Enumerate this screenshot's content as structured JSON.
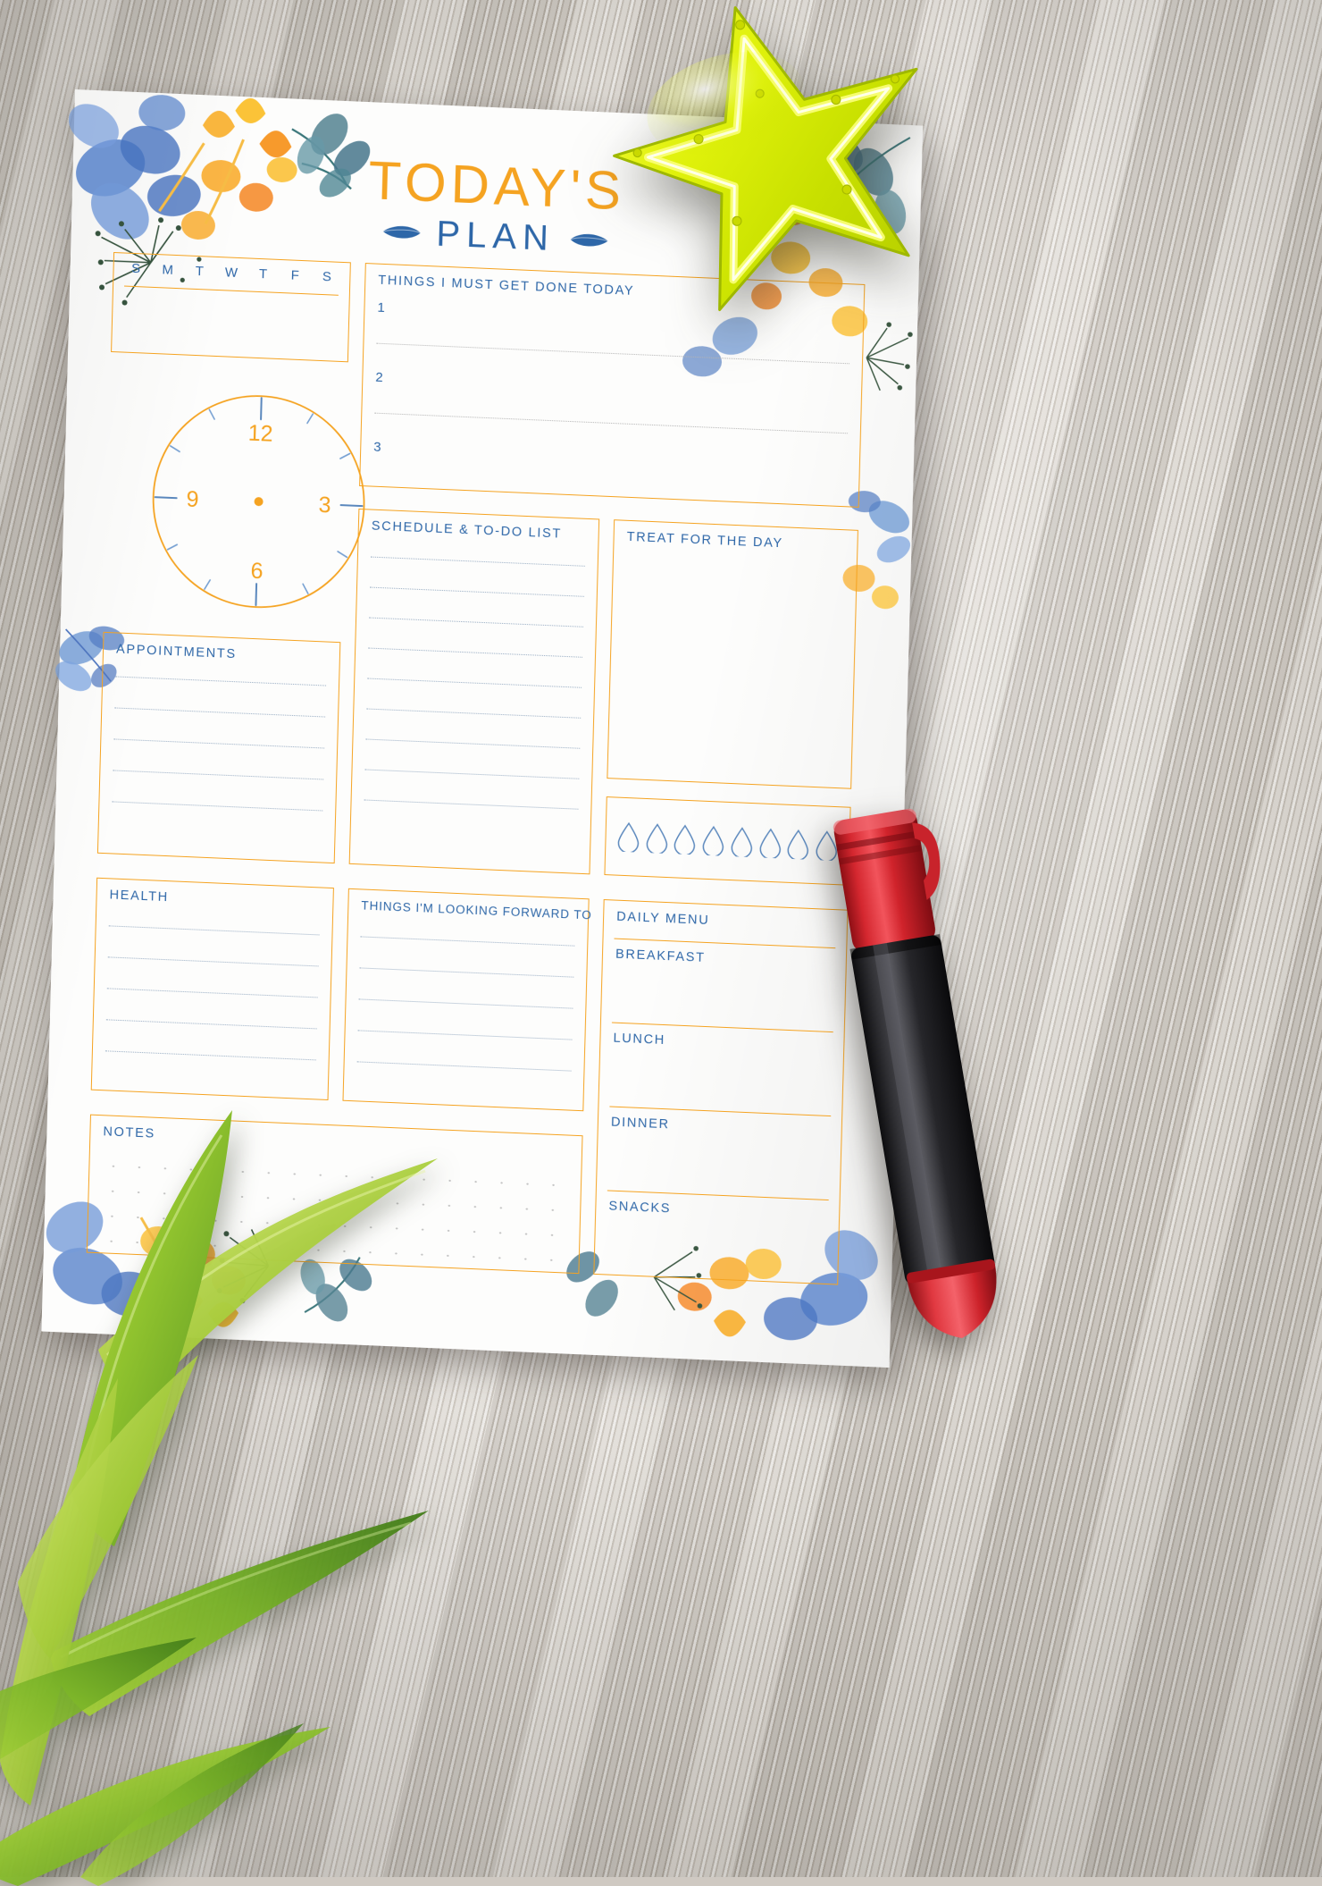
{
  "page": {
    "title_main": "TODAY'S",
    "title_sub": "PLAN"
  },
  "calendar": {
    "days": [
      "S",
      "M",
      "T",
      "W",
      "T",
      "F",
      "S"
    ]
  },
  "must_do": {
    "label": "THINGS I MUST GET DONE TODAY",
    "items": [
      "1",
      "2",
      "3"
    ]
  },
  "clock": {
    "numbers": [
      "12",
      "3",
      "6",
      "9"
    ],
    "face_color": "#F5A321",
    "tick_color": "#5b88bd",
    "center_dot_color": "#F5A321"
  },
  "appointments": {
    "label": "APPOINTMENTS"
  },
  "schedule": {
    "label": "SCHEDULE & TO-DO LIST"
  },
  "treat": {
    "label": "TREAT FOR THE DAY"
  },
  "water": {
    "drop_count": 8
  },
  "health": {
    "label": "HEALTH"
  },
  "looking_forward": {
    "label": "THINGS I'M LOOKING FORWARD TO"
  },
  "daily_menu": {
    "label": "DAILY MENU",
    "meals": [
      "BREAKFAST",
      "LUNCH",
      "DINNER",
      "SNACKS"
    ]
  },
  "notes": {
    "label": "NOTES"
  },
  "colors": {
    "accent_orange": "#F5A321",
    "accent_blue": "#2E67A8",
    "line_gray": "#b6b6b6",
    "paper": "#fdfdfc"
  },
  "objects": {
    "star": "neon-star-yellow",
    "pen": "red-black-marker",
    "plant": "green-leaves",
    "background": "gray-wood-desk"
  }
}
